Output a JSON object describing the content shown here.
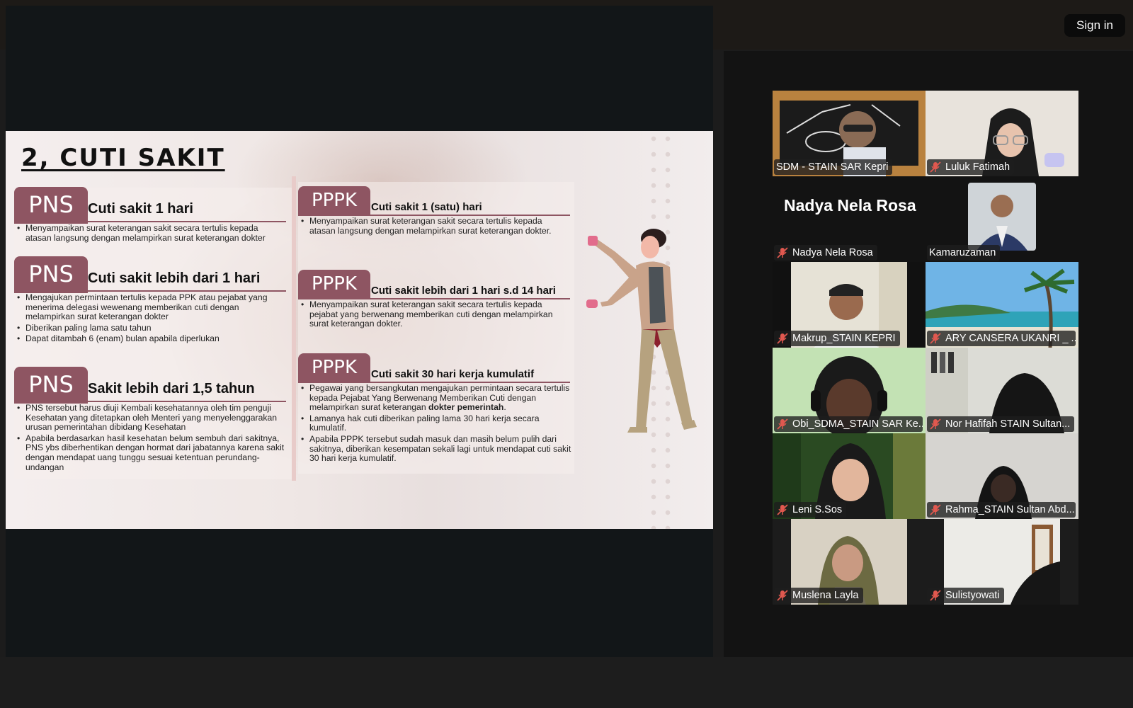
{
  "header": {
    "signin_label": "Sign in"
  },
  "slide": {
    "title": "2, CUTI SAKIT",
    "left_blocks": [
      {
        "tag": "PNS",
        "title": "Cuti sakit 1 hari",
        "bullets": [
          "Menyampaikan surat keterangan sakit secara tertulis kepada atasan langsung dengan melampirkan surat keterangan dokter"
        ]
      },
      {
        "tag": "PNS",
        "title": "Cuti sakit lebih dari 1 hari",
        "bullets": [
          "Mengajukan permintaan tertulis kepada PPK atau pejabat yang menerima delegasi wewenang memberikan cuti dengan melampirkan surat keterangan dokter",
          "Diberikan paling lama satu tahun",
          "Dapat ditambah 6 (enam) bulan apabila diperlukan"
        ]
      },
      {
        "tag": "PNS",
        "title": "Sakit lebih dari 1,5 tahun",
        "bullets": [
          "PNS tersebut harus diuji Kembali kesehatannya oleh tim penguji Kesehatan yang ditetapkan oleh Menteri yang menyelenggarakan urusan pemerintahan dibidang Kesehatan",
          "Apabila berdasarkan hasil kesehatan belum sembuh dari sakitnya, PNS ybs diberhentikan dengan hormat dari jabatannya karena sakit dengan mendapat uang tunggu sesuai ketentuan perundang-undangan"
        ]
      }
    ],
    "right_blocks": [
      {
        "tag": "PPPK",
        "title": "Cuti sakit 1 (satu) hari",
        "bullets": [
          "Menyampaikan surat keterangan sakit secara tertulis kepada atasan langsung dengan melampirkan surat keterangan dokter."
        ]
      },
      {
        "tag": "PPPK",
        "title": "Cuti sakit lebih dari 1 hari s.d 14 hari",
        "bullets": [
          "Menyampaikan surat keterangan sakit secara tertulis kepada pejabat yang berwenang memberikan cuti dengan melampirkan surat keterangan dokter."
        ]
      },
      {
        "tag": "PPPK",
        "title": "Cuti sakit 30 hari kerja kumulatif",
        "bullet1_pre": "Pegawai yang bersangkutan mengajukan permintaan secara tertulis kepada Pejabat Yang Berwenang Memberikan Cuti dengan melampirkan surat keterangan ",
        "bullet1_bold": "dokter pemerintah",
        "bullet1_post": ".",
        "bullets": [
          "Lamanya hak cuti diberikan paling lama 30 hari kerja secara kumulatif.",
          "Apabila PPPK tersebut sudah masuk dan masih belum pulih dari sakitnya, diberikan kesempatan sekali lagi untuk mendapat cuti sakit 30 hari kerja kumulatif."
        ]
      }
    ]
  },
  "participants": {
    "featured_text": "Nadya Nela Rosa",
    "tiles": [
      {
        "name": "SDM - STAIN SAR Kepri",
        "muted": false,
        "active": true
      },
      {
        "name": "Luluk Fatimah",
        "muted": true
      },
      {
        "name": "Nadya Nela Rosa",
        "muted": true
      },
      {
        "name": "Kamaruzaman",
        "muted": false
      },
      {
        "name": "Makrup_STAIN KEPRI",
        "muted": true
      },
      {
        "name": "ARY CANSERA UKANRI _ ...",
        "muted": true
      },
      {
        "name": "Obi_SDMA_STAIN SAR Ke...",
        "muted": true
      },
      {
        "name": "Nor Hafifah STAIN Sultan...",
        "muted": true
      },
      {
        "name": "Leni S.Sos",
        "muted": true
      },
      {
        "name": "Rahma_STAIN Sultan Abd...",
        "muted": true
      },
      {
        "name": "Muslena Layla",
        "muted": true
      },
      {
        "name": "Sulistyowati",
        "muted": true
      }
    ]
  },
  "colors": {
    "accent_tag": "#8e5562",
    "active_speaker": "#23d860",
    "muted_mic": "#e0584f"
  },
  "icons": {
    "mic": "mic-muted-icon"
  }
}
